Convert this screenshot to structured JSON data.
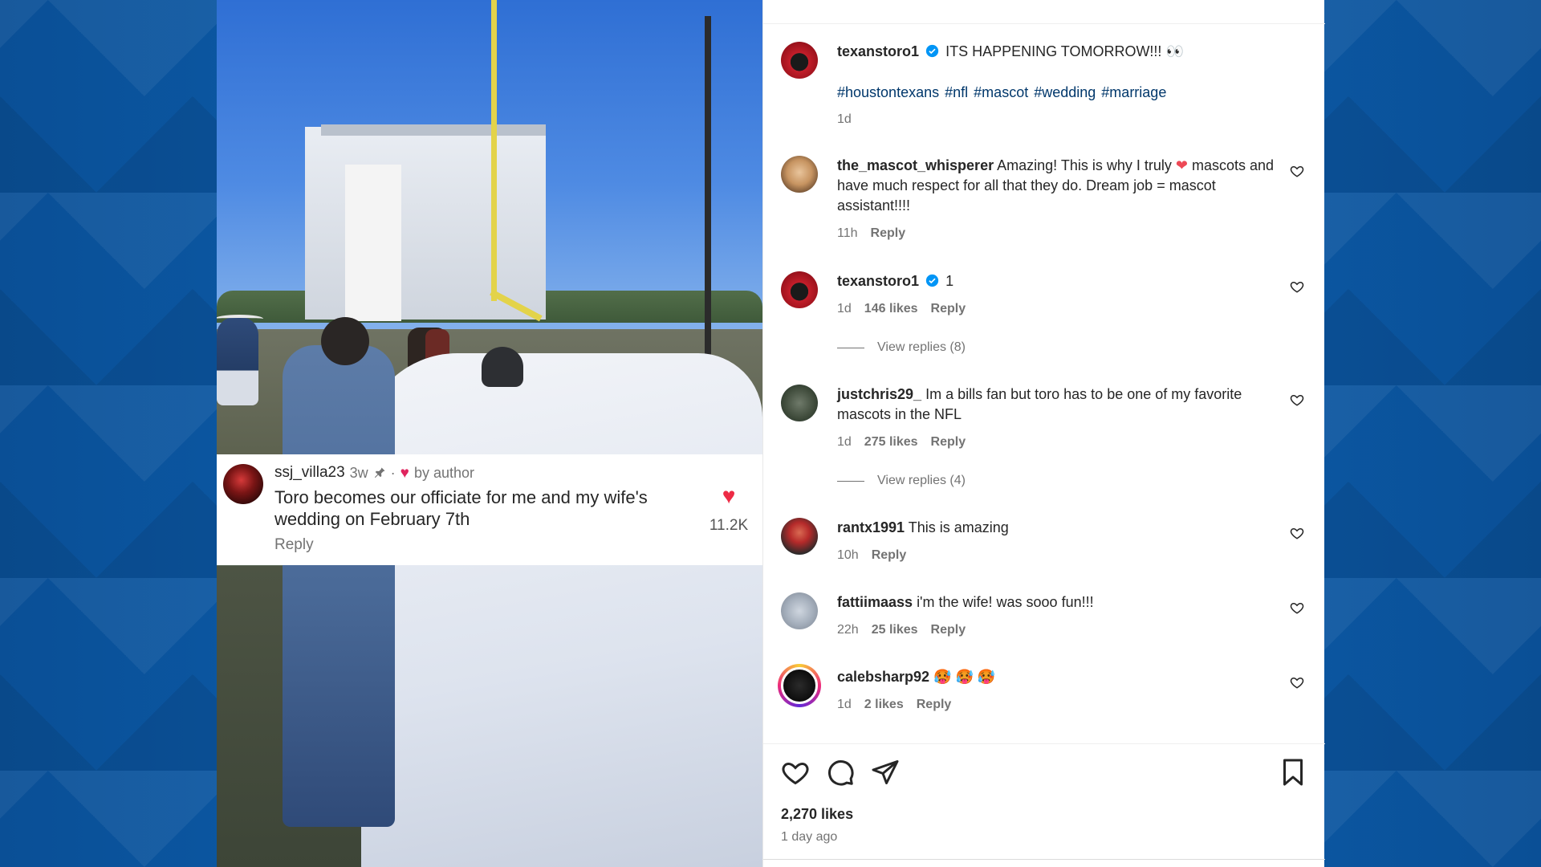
{
  "media": {
    "overlay_comment": {
      "username": "ssj_villa23",
      "age": "3w",
      "separator": "·",
      "liked_by": "by author",
      "text": "Toro becomes our officiate for me and my wife's wedding on February 7th",
      "reply_label": "Reply",
      "like_count": "11.2K"
    }
  },
  "post": {
    "author": "texanstoro1",
    "caption": "ITS HAPPENING TOMORROW!!! 👀",
    "hashtags": [
      "#houstontexans",
      "#nfl",
      "#mascot",
      "#wedding",
      "#marriage"
    ],
    "age": "1d"
  },
  "comments": [
    {
      "username": "the_mascot_whisperer",
      "text_before": "Amazing! This is why I truly",
      "emoji": "❤",
      "text_after": "mascots and have much respect for all that they do. Dream job = mascot assistant!!!!",
      "age": "11h",
      "likes": "",
      "reply": "Reply"
    },
    {
      "username": "texanstoro1",
      "text": "1",
      "age": "1d",
      "likes": "146 likes",
      "reply": "Reply",
      "view_replies": "View replies (8)"
    },
    {
      "username": "justchris29_",
      "text": "Im a bills fan but toro has to be one of my favorite mascots in the NFL",
      "age": "1d",
      "likes": "275 likes",
      "reply": "Reply",
      "view_replies": "View replies (4)"
    },
    {
      "username": "rantx1991",
      "text": "This is amazing",
      "age": "10h",
      "reply": "Reply"
    },
    {
      "username": "fattiimaass",
      "text": "i'm the wife! was sooo fun!!!",
      "age": "22h",
      "likes": "25 likes",
      "reply": "Reply"
    },
    {
      "username": "calebsharp92",
      "text": "🥵 🥵 🥵",
      "age": "1d",
      "likes": "2 likes",
      "reply": "Reply"
    }
  ],
  "footer": {
    "likes": "2,270 likes",
    "time_ago": "1 day ago"
  },
  "colors": {
    "background": "#0b5aa6",
    "link": "#00376b",
    "heart": "#ed4956",
    "verified": "#0095f6"
  },
  "icons": [
    "like-icon",
    "comment-icon",
    "share-icon",
    "bookmark-icon",
    "verified-badge-icon",
    "pin-icon"
  ]
}
